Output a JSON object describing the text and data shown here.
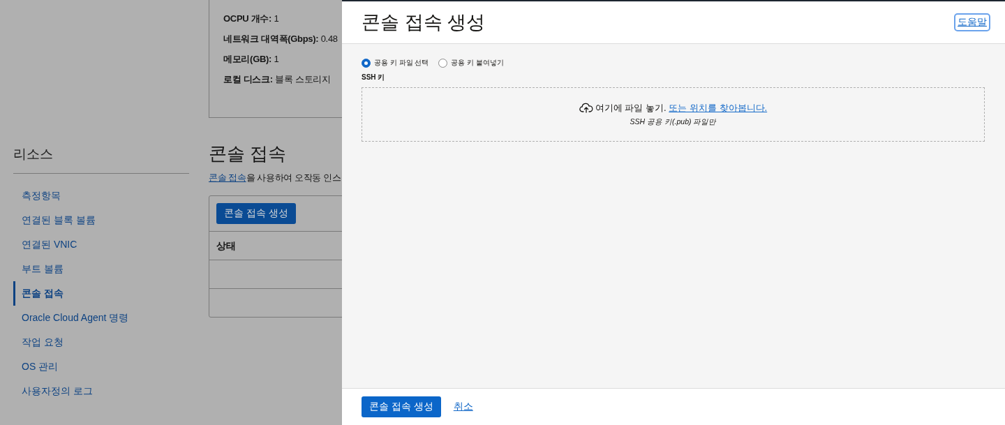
{
  "details": [
    {
      "label": "OCPU 개수:",
      "value": "1"
    },
    {
      "label": "네트워크 대역폭(Gbps):",
      "value": "0.48"
    },
    {
      "label": "메모리(GB):",
      "value": "1"
    },
    {
      "label": "로컬 디스크:",
      "value": "블록 스토리지"
    }
  ],
  "sidebar": {
    "title": "리소스",
    "items": [
      {
        "label": "측정항목",
        "selected": false
      },
      {
        "label": "연결된 블록 볼륨",
        "selected": false
      },
      {
        "label": "연결된 VNIC",
        "selected": false
      },
      {
        "label": "부트 볼륨",
        "selected": false
      },
      {
        "label": "콘솔 접속",
        "selected": true
      },
      {
        "label": "Oracle Cloud Agent 명령",
        "selected": false
      },
      {
        "label": "작업 요청",
        "selected": false
      },
      {
        "label": "OS 관리",
        "selected": false
      },
      {
        "label": "사용자정의 로그",
        "selected": false
      }
    ]
  },
  "section": {
    "title": "콘솔 접속",
    "description_link": "콘솔 접속",
    "description_rest": "을 사용하여 오작동 인스",
    "create_button": "콘솔 접속 생성",
    "columns": [
      "상태"
    ]
  },
  "panel": {
    "title": "콘솔 접속 생성",
    "help_link": "도움말",
    "key_source": [
      {
        "label": "공용 키 파일 선택",
        "selected": true
      },
      {
        "label": "공용 키 붙여넣기",
        "selected": false
      }
    ],
    "ssh_key_label": "SSH 키",
    "dropzone": {
      "text": "여기에 파일 놓기. ",
      "link": "또는 위치를 찾아봅니다.",
      "hint": "SSH 공용 키(.pub) 파일만"
    },
    "footer": {
      "primary_button": "콘솔 접속 생성",
      "cancel_link": "취소"
    }
  }
}
